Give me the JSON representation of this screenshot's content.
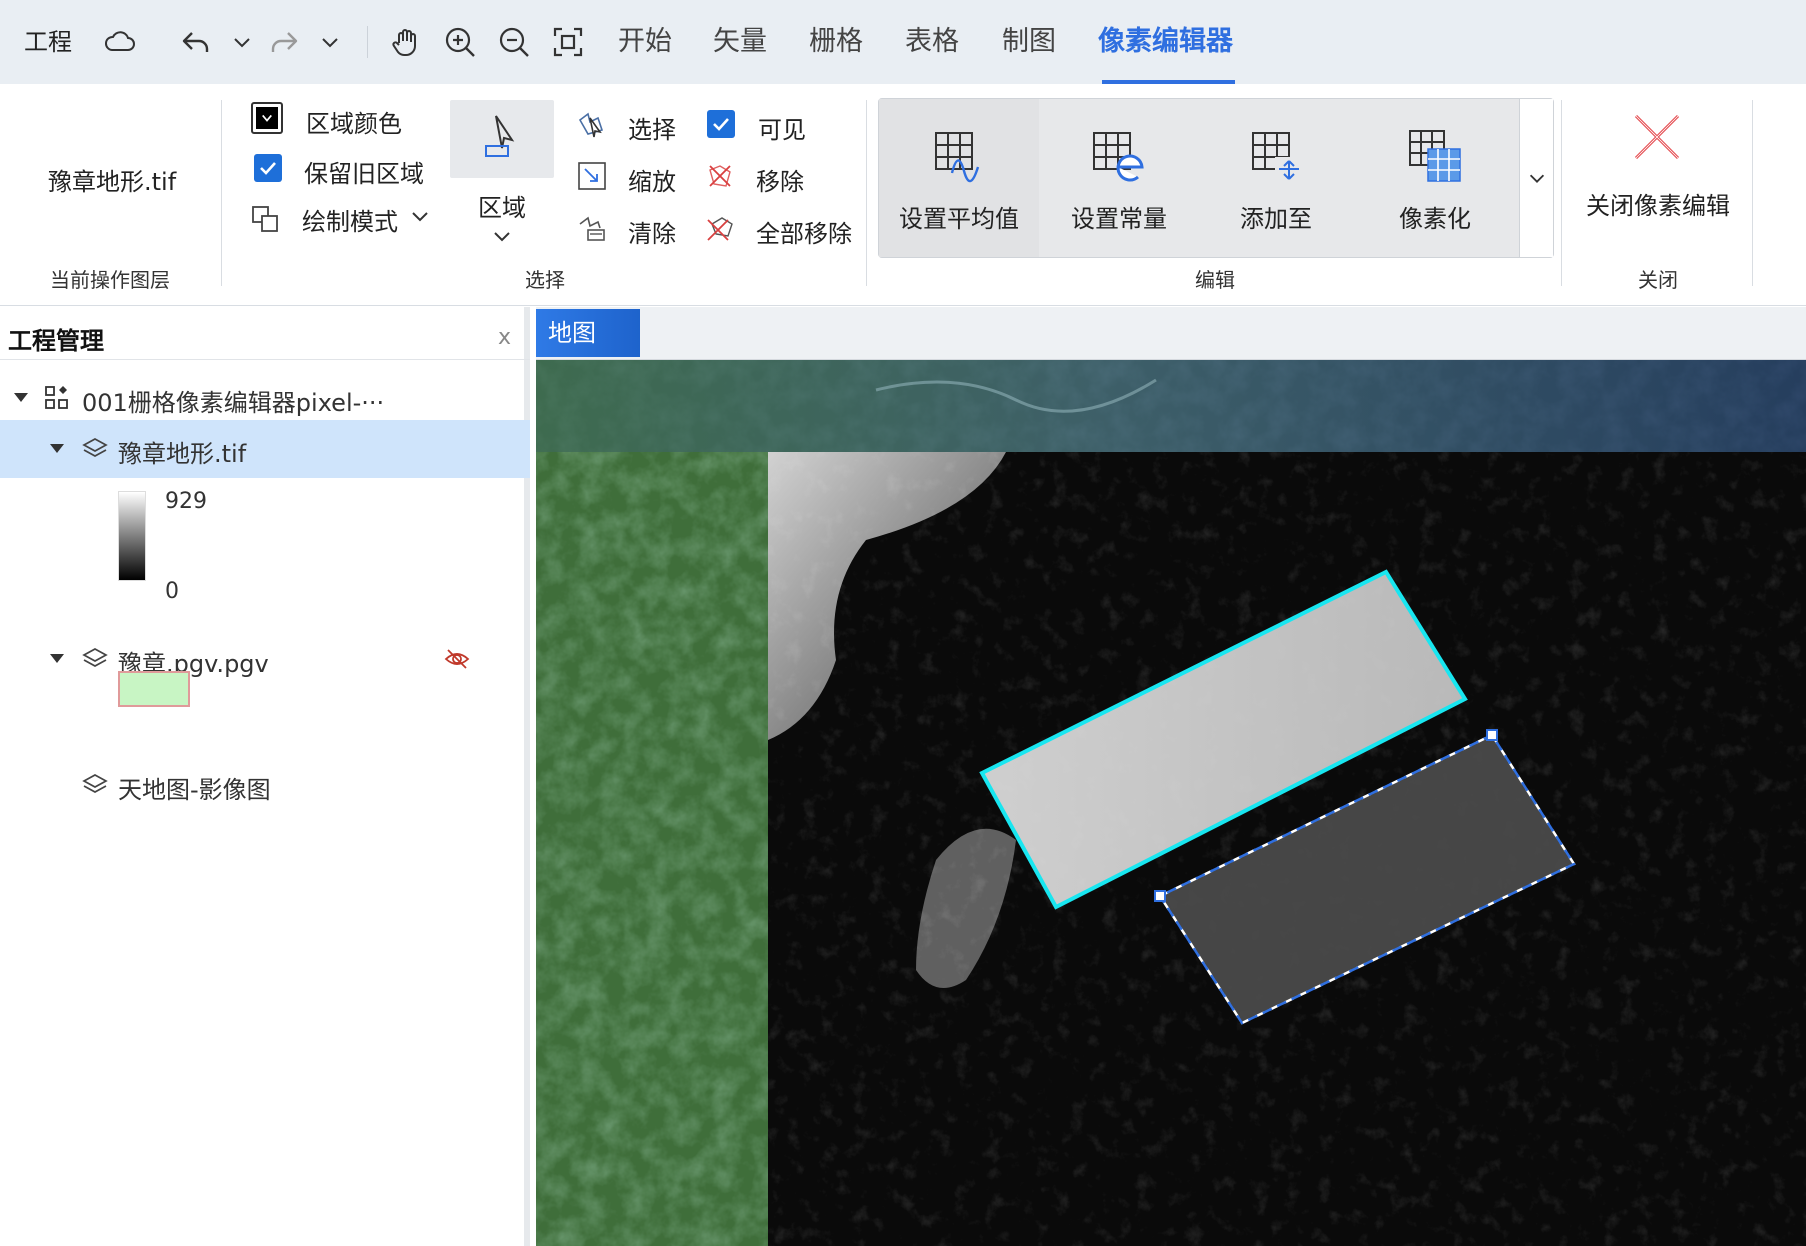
{
  "menubar": {
    "project": "工程",
    "items": [
      "开始",
      "矢量",
      "栅格",
      "表格",
      "制图",
      "像素编辑器"
    ],
    "active_index": 5,
    "active_color": "#2f6fe0",
    "toolbar_icons": [
      "cloud-icon",
      "undo-icon",
      "undo-dropdown-icon",
      "redo-icon",
      "redo-dropdown-icon",
      "pan-hand-icon",
      "zoom-in-icon",
      "zoom-out-icon",
      "full-extent-icon"
    ]
  },
  "ribbon": {
    "current_layer": {
      "value": "豫章地形.tif",
      "group_label": "当前操作图层"
    },
    "select_group": {
      "area_color_label": "区域颜色",
      "keep_old_area_label": "保留旧区域",
      "keep_old_area_checked": true,
      "draw_mode_label": "绘制模式",
      "region_label": "区域",
      "select_label": "选择",
      "zoom_label": "缩放",
      "clear_label": "清除",
      "visible_label": "可见",
      "visible_checked": true,
      "remove_label": "移除",
      "remove_all_label": "全部移除",
      "group_label": "选择"
    },
    "edit_group": {
      "items": [
        {
          "label": "设置平均值",
          "icon": "grid-wave-icon"
        },
        {
          "label": "设置常量",
          "icon": "grid-constant-icon"
        },
        {
          "label": "添加至",
          "icon": "grid-add-icon"
        },
        {
          "label": "像素化",
          "icon": "grid-pixelate-icon"
        }
      ],
      "group_label": "编辑"
    },
    "close_group": {
      "close_label": "关闭像素编辑",
      "group_label": "关闭"
    }
  },
  "left_panel": {
    "title": "工程管理",
    "close": "x",
    "project_name": "001栅格像素编辑器pixel-···",
    "layers": [
      {
        "name": "豫章地形.tif",
        "selected": true,
        "legend_max": "929",
        "legend_min": "0"
      },
      {
        "name": "豫章.pgv.pgv",
        "selected": false,
        "hidden": true,
        "swatch_fill": "#c8f5c4",
        "swatch_border": "#e09a9a"
      },
      {
        "name": "天地图-影像图",
        "selected": false
      }
    ]
  },
  "map": {
    "tab_label": "地图"
  }
}
